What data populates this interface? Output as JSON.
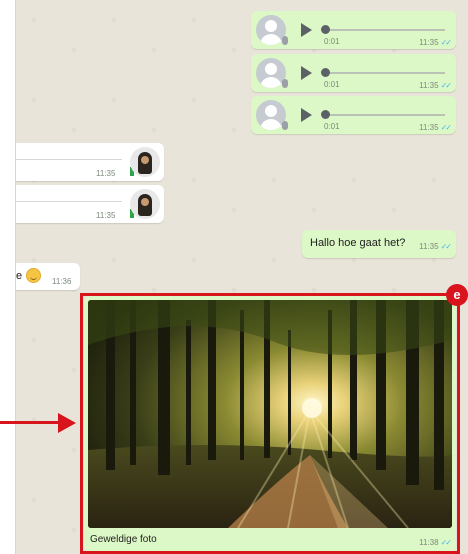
{
  "voice_messages": [
    {
      "duration": "0:01",
      "time": "11:35"
    },
    {
      "duration": "0:01",
      "time": "11:35"
    },
    {
      "duration": "0:01",
      "time": "11:35"
    }
  ],
  "incoming_media": [
    {
      "time": "11:35"
    },
    {
      "time": "11:35"
    }
  ],
  "outgoing_text": {
    "text": "Hallo hoe gaat het?",
    "time": "11:35"
  },
  "incoming_text": {
    "text_fragment": "e",
    "time": "11:36"
  },
  "image_message": {
    "caption": "Geweldige foto",
    "time": "11:38"
  },
  "annotation": {
    "badge_label": "e",
    "color": "#d8141c"
  },
  "colors": {
    "chat_background": "#e9e4d9",
    "outgoing_bubble": "#dcf8c6",
    "incoming_bubble": "#ffffff",
    "read_ticks": "#4fb6ec"
  },
  "icons": {
    "play": "play-icon",
    "read_receipt": "double-check-icon",
    "emoji": "smiley-emoji-icon",
    "download": "download-icon"
  }
}
